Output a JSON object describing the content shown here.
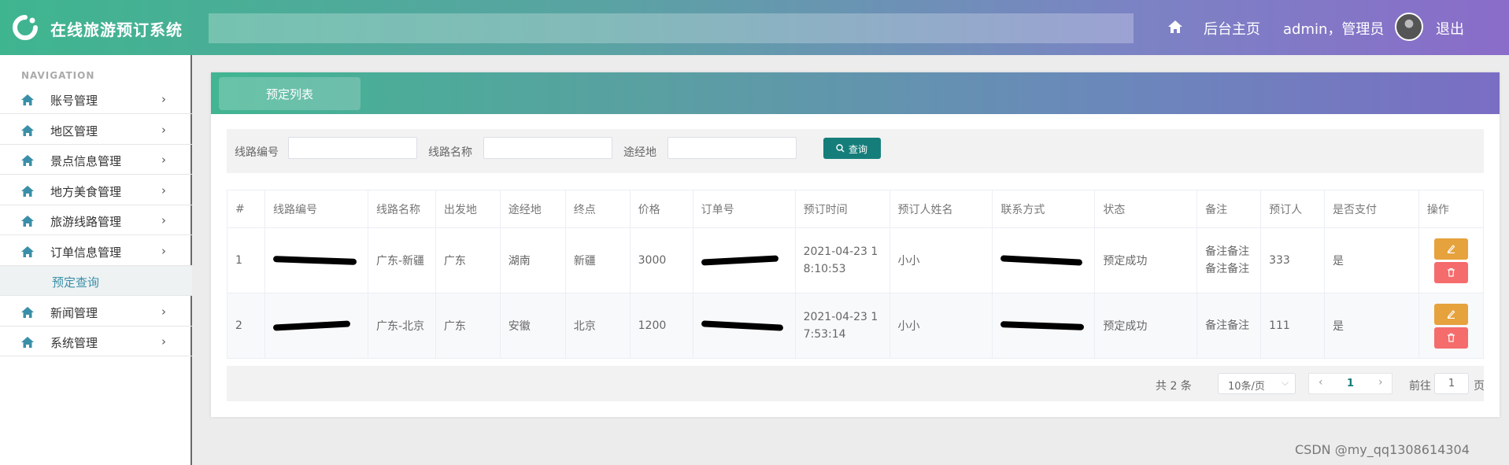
{
  "header": {
    "app_title": "在线旅游预订系统",
    "home_link": "后台主页",
    "user_label": "admin，管理员",
    "logout": "退出"
  },
  "sidebar": {
    "heading": "NAVIGATION",
    "items": [
      {
        "label": "账号管理",
        "icon": "home-icon"
      },
      {
        "label": "地区管理",
        "icon": "home-icon"
      },
      {
        "label": "景点信息管理",
        "icon": "home-icon"
      },
      {
        "label": "地方美食管理",
        "icon": "home-icon"
      },
      {
        "label": "旅游线路管理",
        "icon": "home-icon"
      },
      {
        "label": "订单信息管理",
        "icon": "home-icon"
      },
      {
        "label": "新闻管理",
        "icon": "home-icon"
      },
      {
        "label": "系统管理",
        "icon": "home-icon"
      }
    ],
    "sub_item": "预定查询",
    "chevron": "›"
  },
  "panel": {
    "tab_title": "预定列表"
  },
  "filters": {
    "route_no_label": "线路编号",
    "route_name_label": "线路名称",
    "via_label": "途经地",
    "search_button": "查询"
  },
  "table": {
    "columns": [
      "#",
      "线路编号",
      "线路名称",
      "出发地",
      "途经地",
      "终点",
      "价格",
      "订单号",
      "预订时间",
      "预订人姓名",
      "联系方式",
      "状态",
      "备注",
      "预订人",
      "是否支付",
      "操作"
    ],
    "rows": [
      {
        "idx": "1",
        "route_name": "广东-新疆",
        "depart": "广东",
        "via": "湖南",
        "dest": "新疆",
        "price": "3000",
        "time_a": "2021-04-23 1",
        "time_b": "8:10:53",
        "name": "小小",
        "status": "预定成功",
        "note_a": "备注备注",
        "note_b": "备注备注",
        "booker": "333",
        "paid": "是"
      },
      {
        "idx": "2",
        "route_name": "广东-北京",
        "depart": "广东",
        "via": "安徽",
        "dest": "北京",
        "price": "1200",
        "time_a": "2021-04-23 1",
        "time_b": "7:53:14",
        "name": "小小",
        "status": "预定成功",
        "note_a": "备注备注",
        "note_b": "",
        "booker": "111",
        "paid": "是"
      }
    ]
  },
  "pager": {
    "total": "共 2 条",
    "page_size": "10条/页",
    "current": "1",
    "goto_label": "前往",
    "goto_value": "1",
    "page_unit": "页"
  },
  "watermark": "CSDN @my_qq1308614304",
  "colors": {
    "accent": "#167e7a",
    "edit": "#e6a23c",
    "delete": "#f56c6c"
  }
}
